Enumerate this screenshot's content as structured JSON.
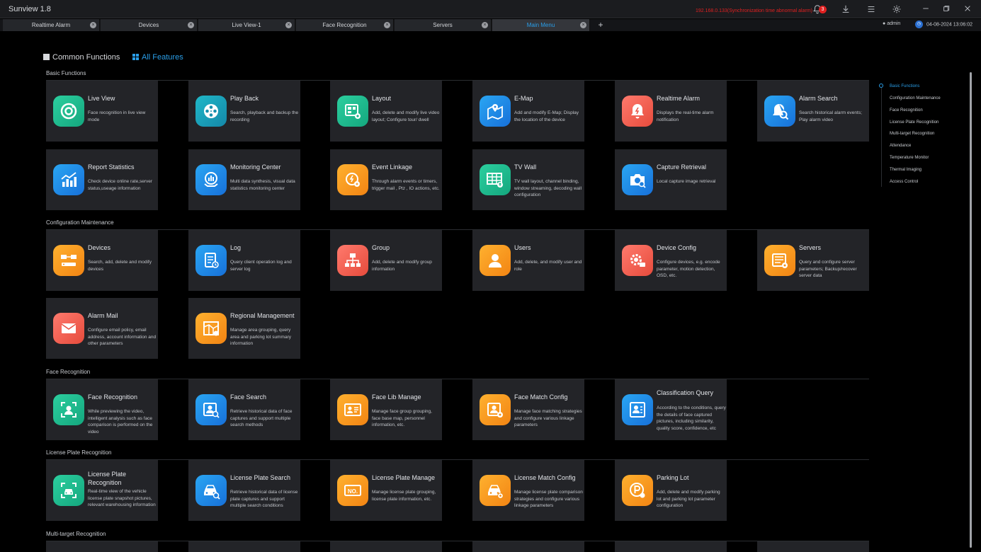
{
  "app": {
    "title": "Sunview 1.8",
    "alert": "192.168.0.133(Synchronization time abnormal alarm)",
    "badge_count": "3"
  },
  "tabs": [
    {
      "label": "Realtime Alarm",
      "active": false
    },
    {
      "label": "Devices",
      "active": false
    },
    {
      "label": "Live View-1",
      "active": false
    },
    {
      "label": "Face Recognition",
      "active": false
    },
    {
      "label": "Servers",
      "active": false
    },
    {
      "label": "Main Menu",
      "active": true
    }
  ],
  "status": {
    "user": "admin",
    "datetime": "04-08-2024 13:06:02"
  },
  "modes": {
    "common": "Common Functions",
    "all": "All Features"
  },
  "sections": {
    "basic": "Basic Functions",
    "config": "Configuration Maintenance",
    "face": "Face Recognition",
    "plate": "License Plate Recognition",
    "multi": "Multi-target Recognition"
  },
  "cards": {
    "live_view": {
      "title": "Live View",
      "desc": "Face recognition in live view mode"
    },
    "play_back": {
      "title": "Play Back",
      "desc": "Search, playback and backup the recording"
    },
    "layout": {
      "title": "Layout",
      "desc": "Add, delete and modify live video layout; Configure tour/ dwell"
    },
    "emap": {
      "title": "E-Map",
      "desc": "Add and modify E-Map; Display the location of the device"
    },
    "realtime_alarm": {
      "title": "Realtime Alarm",
      "desc": "Displays the real-time alarm notification"
    },
    "alarm_search": {
      "title": "Alarm Search",
      "desc": "Search historical alarm events; Play alarm video"
    },
    "report_statistics": {
      "title": "Report Statistics",
      "desc": "Check device online rate,server status,useage information"
    },
    "monitoring_center": {
      "title": "Monitoring Center",
      "desc": "Multi data synthesis, visual data statistics monitoring center"
    },
    "event_linkage": {
      "title": "Event Linkage",
      "desc": "Through alarm events or timers, trigger mail , Ptz , IO actions, etc."
    },
    "tv_wall": {
      "title": "TV Wall",
      "desc": "TV wall layout, channel binding, window streaming, decoding wall configuration"
    },
    "capture_retrieval": {
      "title": "Capture Retrieval",
      "desc": "Local capture image retrieval"
    },
    "devices": {
      "title": "Devices",
      "desc": "Search, add, delete and modify devices"
    },
    "log": {
      "title": "Log",
      "desc": "Query client operation log and server log"
    },
    "group": {
      "title": "Group",
      "desc": "Add, delete and modify group information"
    },
    "users": {
      "title": "Users",
      "desc": "Add, delete, and modify user and role"
    },
    "device_config": {
      "title": "Device Config",
      "desc": "Configure devices, e.g. encode parameter, motion detection, OSD, etc."
    },
    "servers": {
      "title": "Servers",
      "desc": "Query and configure server parameters; Backup/recover server data"
    },
    "alarm_mail": {
      "title": "Alarm Mail",
      "desc": "Configure email policy, email address, account information and other parameters"
    },
    "regional_management": {
      "title": "Regional Management",
      "desc": "Manage area grouping, query area and parking lot summary information"
    },
    "face_recognition": {
      "title": "Face Recognition",
      "desc": "While previewing the video, intelligent analysis such as face comparison is performed on the video"
    },
    "face_search": {
      "title": "Face Search",
      "desc": "Retrieve historical data of face captures and support multiple search methods"
    },
    "face_lib_manage": {
      "title": "Face Lib Manage",
      "desc": "Manage face group grouping, face base map, personnel information, etc."
    },
    "face_match_config": {
      "title": "Face Match Config",
      "desc": "Manage face matching strategies and configure various linkage parameters"
    },
    "classification_query": {
      "title": "Classification Query",
      "desc": "According to the conditions, query the details of face captured pictures, including similarity, quality score, confidence, etc"
    },
    "lpr": {
      "title": "License Plate Recognition",
      "desc": "Real-time view of the vehicle license plate snapshot pictures, relevant warehousing information"
    },
    "lp_search": {
      "title": "License Plate Search",
      "desc": "Retrieve historical data of license plate captures and support multiple search conditions"
    },
    "lp_manage": {
      "title": "License Plate Manage",
      "desc": "Manage license plate grouping, license plate information, etc."
    },
    "lp_match": {
      "title": "License Match Config",
      "desc": "Manage license plate comparison strategies and configure various linkage parameters"
    },
    "parking_lot": {
      "title": "Parking Lot",
      "desc": "Add, delete and modify parking lot and parking lot parameter configuration"
    }
  },
  "right_nav": [
    "Basic Functions",
    "Configuration Maintenance",
    "Face Recognition",
    "License Plate Recognition",
    "Multi-target Recognition",
    "Attendance",
    "Temperature Monitor",
    "Thermal Imaging",
    "Access Control"
  ],
  "icon_plate_text": "NO.",
  "colors": {
    "accent": "#2a9ee8",
    "alert": "#e02020",
    "green": "#1fbf8f",
    "blue": "#1e88e5",
    "orange": "#f99a1c",
    "red": "#ef5b4c"
  }
}
